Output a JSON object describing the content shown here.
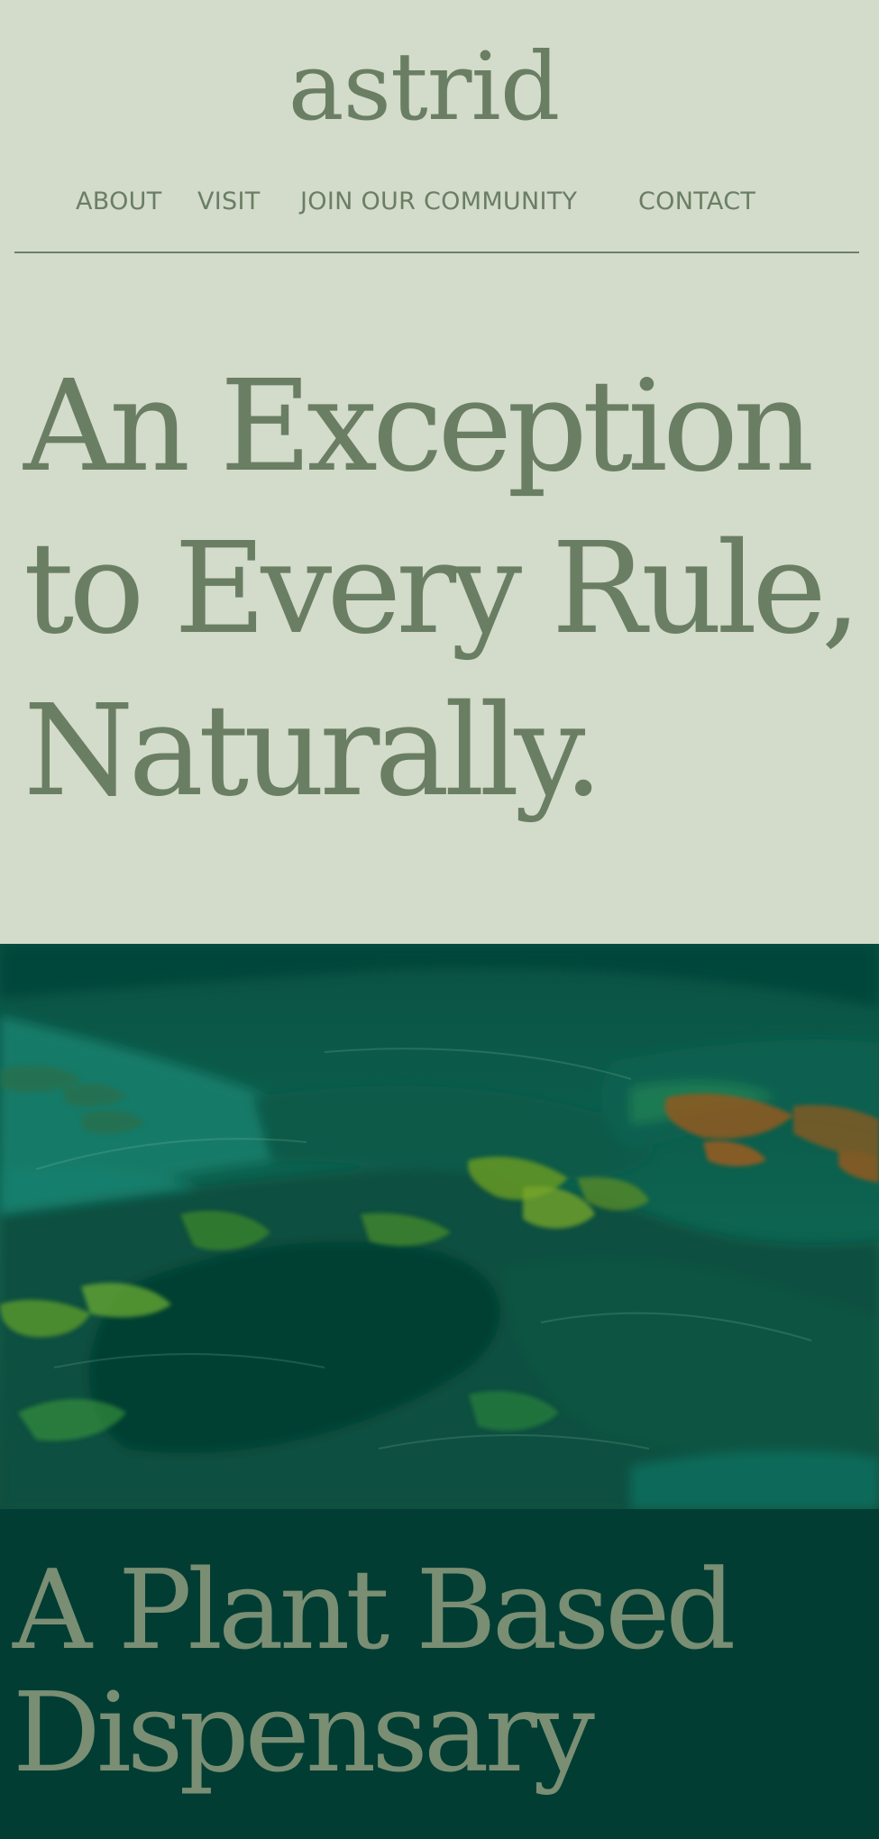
{
  "brand": {
    "logo_text": "astrid"
  },
  "nav": {
    "items": [
      {
        "label": "ABOUT"
      },
      {
        "label": "VISIT"
      },
      {
        "label": "JOIN OUR COMMUNITY"
      },
      {
        "label": "CONTACT"
      }
    ]
  },
  "hero": {
    "line1": "An Exception",
    "line2": "to Every Rule,",
    "line3": "Naturally."
  },
  "feature": {
    "image_description": "green-painting-artwork"
  },
  "tagline": {
    "line1": "A Plant Based",
    "line2": "Dispensary"
  },
  "colors": {
    "background": "#d3dbca",
    "text_green": "#6a7e63",
    "dark_section": "#013d33",
    "tagline_text": "#7a8e74"
  }
}
